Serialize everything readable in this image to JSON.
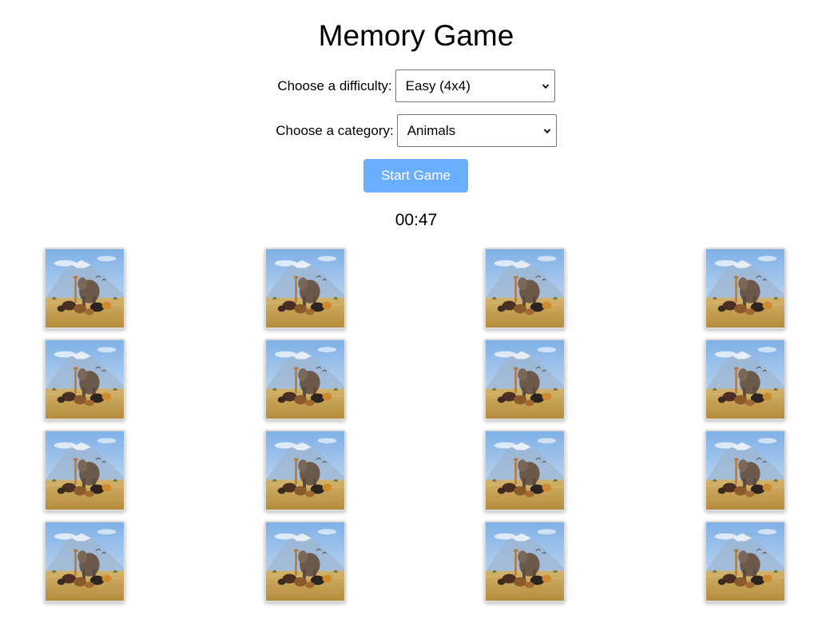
{
  "header": {
    "title": "Memory Game"
  },
  "controls": {
    "difficulty": {
      "label": "Choose a difficulty:",
      "value": "Easy (4x4)",
      "chevron_icon": "chevron-down-icon"
    },
    "category": {
      "label": "Choose a category:",
      "value": "Animals",
      "chevron_icon": "chevron-down-icon"
    },
    "start_label": "Start Game",
    "start_color": "#6aafff"
  },
  "timer": {
    "value": "00:47"
  },
  "board": {
    "rows": 4,
    "cols": 4,
    "card_state": "face-down",
    "card_back_icon": "safari-animals-image"
  }
}
